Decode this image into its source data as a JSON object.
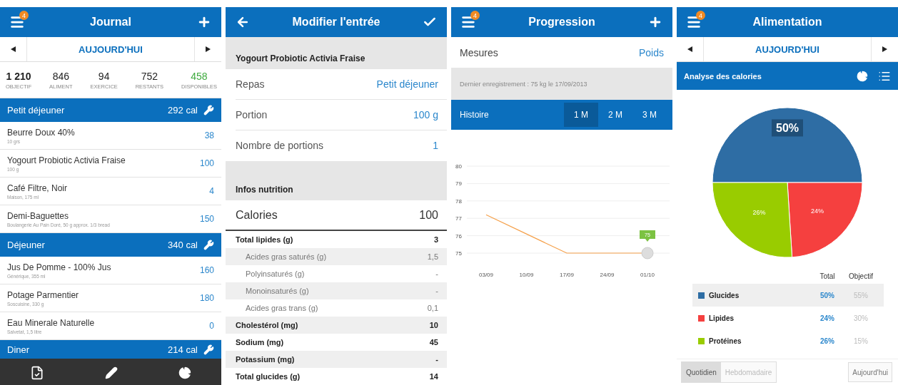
{
  "journal": {
    "title": "Journal",
    "badge": "4",
    "date": "AUJOURD'HUI",
    "summary": [
      {
        "value": "1 210",
        "label": "OBJECTIF",
        "kind": "goal"
      },
      {
        "value": "846",
        "label": "ALIMENT",
        "kind": "plain"
      },
      {
        "value": "94",
        "label": "EXERCICE",
        "kind": "plain"
      },
      {
        "value": "752",
        "label": "RESTANTS",
        "kind": "plain"
      },
      {
        "value": "458",
        "label": "DISPONIBLES",
        "kind": "positive"
      }
    ],
    "meals": [
      {
        "name": "Petit déjeuner",
        "calories": "292 cal",
        "items": [
          {
            "name": "Beurre Doux 40%",
            "detail": "10 grs",
            "calories": "38"
          },
          {
            "name": "Yogourt Probiotic Activia Fraise",
            "detail": "100 g",
            "calories": "100"
          },
          {
            "name": "Café Filtre, Noir",
            "detail": "Maison, 175 ml",
            "calories": "4"
          },
          {
            "name": "Demi-Baguettes",
            "detail": "Boulangerie Au Pain Doré, 50 g approx. 1/3 bread",
            "calories": "150"
          }
        ]
      },
      {
        "name": "Déjeuner",
        "calories": "340 cal",
        "items": [
          {
            "name": "Jus De Pomme - 100% Jus",
            "detail": "Générique, 355 ml",
            "calories": "160"
          },
          {
            "name": "Potage Parmentier",
            "detail": "Soscuisine, 330 g",
            "calories": "180"
          },
          {
            "name": "Eau Minerale Naturelle",
            "detail": "Salvetat, 1,5 litre",
            "calories": "0"
          }
        ]
      },
      {
        "name": "Diner",
        "calories": "214 cal"
      }
    ]
  },
  "edit": {
    "title": "Modifier l'entrée",
    "food": "Yogourt Probiotic Activia Fraise",
    "fields": [
      {
        "label": "Repas",
        "value": "Petit déjeuner"
      },
      {
        "label": "Portion",
        "value": "100 g"
      },
      {
        "label": "Nombre de portions",
        "value": "1"
      }
    ],
    "section": "Infos nutrition",
    "calories": {
      "label": "Calories",
      "value": "100"
    },
    "nutrients": [
      {
        "label": "Total lipides (g)",
        "value": "3",
        "kind": "main"
      },
      {
        "label": "Acides gras saturés (g)",
        "value": "1,5",
        "kind": "sub"
      },
      {
        "label": "Polyinsaturés (g)",
        "value": "-",
        "kind": "sub"
      },
      {
        "label": "Monoinsaturés (g)",
        "value": "-",
        "kind": "sub"
      },
      {
        "label": "Acides gras trans (g)",
        "value": "0,1",
        "kind": "sub"
      },
      {
        "label": "Cholestérol (mg)",
        "value": "10",
        "kind": "main"
      },
      {
        "label": "Sodium (mg)",
        "value": "45",
        "kind": "main"
      },
      {
        "label": "Potassium (mg)",
        "value": "-",
        "kind": "main"
      },
      {
        "label": "Total glucides (g)",
        "value": "14",
        "kind": "main"
      }
    ]
  },
  "progress": {
    "title": "Progression",
    "badge": "4",
    "measure": {
      "label": "Mesures",
      "value": "Poids"
    },
    "last_entry": "Dernier enregistrement : 75 kg le 17/09/2013",
    "history": {
      "label": "Histoire",
      "ranges": [
        {
          "label": "1 M",
          "selected": true
        },
        {
          "label": "2 M",
          "selected": false
        },
        {
          "label": "3 M",
          "selected": false
        }
      ]
    },
    "chart_data": {
      "type": "line",
      "categories": [
        "03/09",
        "10/09",
        "17/09",
        "24/09",
        "01/10"
      ],
      "series": [
        {
          "color": "#f5a04a",
          "values": [
            77.2,
            76.1,
            75,
            75,
            75
          ]
        }
      ],
      "grid": true,
      "ylim": [
        75,
        80
      ],
      "yticks": [
        75,
        76,
        77,
        78,
        79,
        80
      ],
      "annotations": [
        "75"
      ]
    }
  },
  "food": {
    "title": "Alimentation",
    "badge": "4",
    "date": "AUJOURD'HUI",
    "section": "Analyse des calories",
    "chart_data": {
      "type": "pie",
      "categories": [
        "Glucides",
        "Lipides",
        "Protéines"
      ],
      "series": [
        {
          "values": [
            50,
            24,
            26
          ]
        }
      ],
      "value_labels": [
        "50%",
        "24%",
        "26%"
      ],
      "legend": true
    },
    "columns": [
      "Total",
      "Objectif"
    ],
    "rows": [
      {
        "color": "#2e6da4",
        "total": "50%",
        "goal": "55%",
        "selected": true
      },
      {
        "color": "#f5403f",
        "total": "24%",
        "goal": "30%",
        "selected": false
      },
      {
        "color": "#99cc00",
        "total": "26%",
        "goal": "15%",
        "selected": false
      }
    ],
    "periods": [
      {
        "label": "Quotidien",
        "selected": true
      },
      {
        "label": "Hebdomadaire",
        "selected": false
      }
    ],
    "today_button": "Aujourd'hui"
  }
}
